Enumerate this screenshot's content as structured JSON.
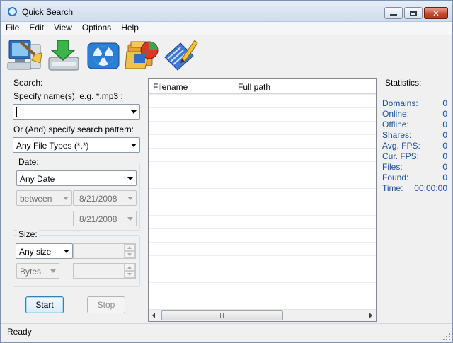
{
  "window": {
    "title": "Quick Search"
  },
  "menu": [
    "File",
    "Edit",
    "View",
    "Options",
    "Help"
  ],
  "toolbar": {
    "buttons": [
      {
        "icon": "computer-broom-icon"
      },
      {
        "icon": "download-icon"
      },
      {
        "icon": "radiation-icon"
      },
      {
        "icon": "folders-icon"
      },
      {
        "icon": "notebook-pencil-icon"
      }
    ]
  },
  "search": {
    "section_label": "Search:",
    "name_label": "Specify name(s), e.g. *.mp3 :",
    "name_value": "",
    "pattern_label": "Or (And) specify search pattern:",
    "pattern_value": "Any File Types (*.*)",
    "date": {
      "label": "Date:",
      "mode": "Any Date",
      "range_mode": "between",
      "from": "8/21/2008",
      "to": "8/21/2008"
    },
    "size": {
      "label": "Size:",
      "mode": "Any size",
      "value": "",
      "unit": "Bytes",
      "value2": ""
    },
    "start_label": "Start",
    "stop_label": "Stop"
  },
  "results": {
    "columns": [
      "Filename",
      "Full path"
    ],
    "rows": []
  },
  "statistics": {
    "title": "Statistics:",
    "items": [
      {
        "label": "Domains:",
        "value": "0"
      },
      {
        "label": "Online:",
        "value": "0"
      },
      {
        "label": "Offline:",
        "value": "0"
      },
      {
        "label": "Shares:",
        "value": "0"
      },
      {
        "label": "Avg. FPS:",
        "value": "0"
      },
      {
        "label": "Cur. FPS:",
        "value": "0"
      },
      {
        "label": "Files:",
        "value": "0"
      },
      {
        "label": "Found:",
        "value": "0"
      },
      {
        "label": "Time:",
        "value": "00:00:00"
      }
    ]
  },
  "status": {
    "text": "Ready"
  },
  "colors": {
    "stats_text": "#1b4f9c",
    "title_gradient_top": "#e6eef8",
    "close_red": "#c5452c"
  }
}
